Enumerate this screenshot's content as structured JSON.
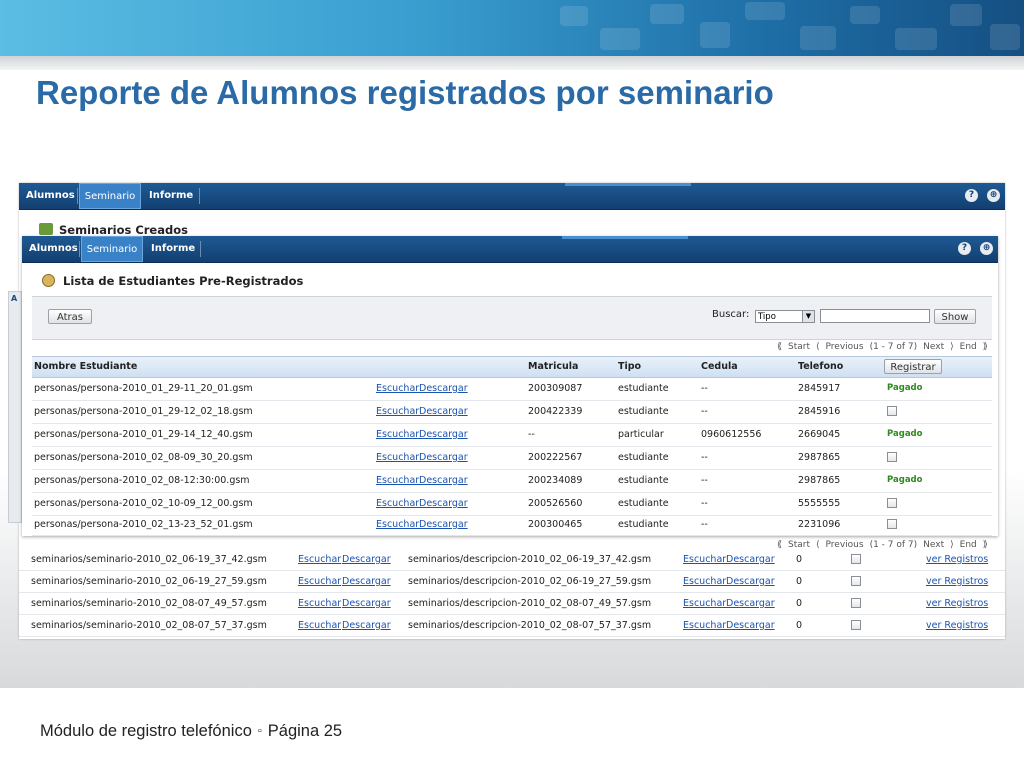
{
  "slide": {
    "title": "Reporte de Alumnos registrados por seminario",
    "footer_text": "Módulo de registro telefónico",
    "footer_separator": "▫",
    "footer_page": "Página 25",
    "accent_color": "#2a6aa6"
  },
  "nav": {
    "alumnos": "Alumnos",
    "seminario": "Seminario",
    "informe": "Informe",
    "help": "?",
    "exit": "⊕"
  },
  "back_window": {
    "title": "Seminarios Creados",
    "side_letter": "A",
    "rows": [
      {
        "archivo": "seminarios/seminario-2010_02_06-19_37_42.gsm",
        "escuchar": "Escuchar",
        "descargar": "Descargar",
        "descripcion": "seminarios/descripcion-2010_02_06-19_37_42.gsm",
        "escuchar2": "Escuchar",
        "descargar2": "Descargar",
        "count": "0",
        "ver": "ver Registros"
      },
      {
        "archivo": "seminarios/seminario-2010_02_06-19_27_59.gsm",
        "escuchar": "Escuchar",
        "descargar": "Descargar",
        "descripcion": "seminarios/descripcion-2010_02_06-19_27_59.gsm",
        "escuchar2": "Escuchar",
        "descargar2": "Descargar",
        "count": "0",
        "ver": "ver Registros"
      },
      {
        "archivo": "seminarios/seminario-2010_02_08-07_49_57.gsm",
        "escuchar": "Escuchar",
        "descargar": "Descargar",
        "descripcion": "seminarios/descripcion-2010_02_08-07_49_57.gsm",
        "escuchar2": "Escuchar",
        "descargar2": "Descargar",
        "count": "0",
        "ver": "ver Registros"
      },
      {
        "archivo": "seminarios/seminario-2010_02_08-07_57_37.gsm",
        "escuchar": "Escuchar",
        "descargar": "Descargar",
        "descripcion": "seminarios/descripcion-2010_02_08-07_57_37.gsm",
        "escuchar2": "Escuchar",
        "descargar2": "Descargar",
        "count": "0",
        "ver": "ver Registros"
      }
    ]
  },
  "front_window": {
    "title": "Lista de Estudiantes Pre-Registrados",
    "back_button": "Atras",
    "search_label": "Buscar:",
    "search_select": "Tipo",
    "search_value": "",
    "show_button": "Show",
    "pager": {
      "start": "Start",
      "previous": "Previous",
      "range": "(1 - 7 of 7)",
      "next": "Next",
      "end": "End"
    },
    "columns": {
      "nombre": "Nombre Estudiante",
      "matricula": "Matricula",
      "tipo": "Tipo",
      "cedula": "Cedula",
      "telefono": "Telefono",
      "registrar_button": "Registrar"
    },
    "links": {
      "escuchar": "Escuchar",
      "descargar": "Descargar"
    },
    "rows": [
      {
        "nombre": "personas/persona-2010_01_29-11_20_01.gsm",
        "matricula": "200309087",
        "tipo": "estudiante",
        "cedula": "--",
        "telefono": "2845917",
        "estado": "Pagado"
      },
      {
        "nombre": "personas/persona-2010_01_29-12_02_18.gsm",
        "matricula": "200422339",
        "tipo": "estudiante",
        "cedula": "--",
        "telefono": "2845916",
        "estado": ""
      },
      {
        "nombre": "personas/persona-2010_01_29-14_12_40.gsm",
        "matricula": "--",
        "tipo": "particular",
        "cedula": "0960612556",
        "telefono": "2669045",
        "estado": "Pagado"
      },
      {
        "nombre": "personas/persona-2010_02_08-09_30_20.gsm",
        "matricula": "200222567",
        "tipo": "estudiante",
        "cedula": "--",
        "telefono": "2987865",
        "estado": ""
      },
      {
        "nombre": "personas/persona-2010_02_08-12:30:00.gsm",
        "matricula": "200234089",
        "tipo": "estudiante",
        "cedula": "--",
        "telefono": "2987865",
        "estado": "Pagado"
      },
      {
        "nombre": "personas/persona-2010_02_10-09_12_00.gsm",
        "matricula": "200526560",
        "tipo": "estudiante",
        "cedula": "--",
        "telefono": "5555555",
        "estado": ""
      },
      {
        "nombre": "personas/persona-2010_02_13-23_52_01.gsm",
        "matricula": "200300465",
        "tipo": "estudiante",
        "cedula": "--",
        "telefono": "2231096",
        "estado": ""
      }
    ]
  }
}
